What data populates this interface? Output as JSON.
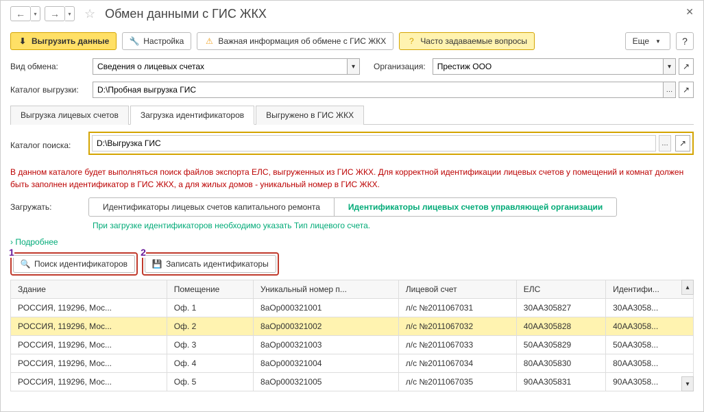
{
  "header": {
    "title": "Обмен данными с ГИС ЖКХ"
  },
  "toolbar": {
    "unload": "Выгрузить данные",
    "settings": "Настройка",
    "warning": "Важная информация об обмене с ГИС ЖКХ",
    "faq": "Часто задаваемые вопросы",
    "more": "Еще"
  },
  "form": {
    "exchange_type_lbl": "Вид обмена:",
    "exchange_type_val": "Сведения о лицевых счетах",
    "org_lbl": "Организация:",
    "org_val": "Престиж ООО",
    "export_dir_lbl": "Каталог выгрузки:",
    "export_dir_val": "D:\\Пробная выгрузка ГИС"
  },
  "tabs": [
    {
      "label": "Выгрузка лицевых счетов",
      "active": false
    },
    {
      "label": "Загрузка идентификаторов",
      "active": true
    },
    {
      "label": "Выгружено в ГИС ЖКХ",
      "active": false
    }
  ],
  "search": {
    "lbl": "Каталог поиска:",
    "val": "D:\\Выгрузка ГИС"
  },
  "hint": "В данном каталоге будет выполняться поиск файлов экспорта ЕЛС, выгруженных из ГИС ЖКХ. Для корректной идентификации лицевых счетов у помещений и комнат должен быть заполнен идентификатор в ГИС ЖКХ, а для жилых домов - уникальный номер в ГИС ЖКХ.",
  "load": {
    "lbl": "Загружать:",
    "opt1": "Идентификаторы лицевых счетов капитального ремонта",
    "opt2": "Идентификаторы лицевых счетов управляющей организации"
  },
  "green_hint": "При загрузке идентификаторов необходимо указать Тип лицевого счета.",
  "more_link": "Подробнее",
  "actions": {
    "search_ids": "Поиск идентификаторов",
    "write_ids": "Записать идентификаторы"
  },
  "table": {
    "cols": [
      "Здание",
      "Помещение",
      "Уникальный номер п...",
      "Лицевой счет",
      "ЕЛС",
      "Идентифи..."
    ],
    "rows": [
      {
        "b": "РОССИЯ, 119296, Мос...",
        "r": "Оф. 1",
        "u": "8аОр000321001",
        "a": "л/с №2011067031",
        "e": "30АА305827",
        "i": "30АА3058..."
      },
      {
        "b": "РОССИЯ, 119296, Мос...",
        "r": "Оф. 2",
        "u": "8аОр000321002",
        "a": "л/с №2011067032",
        "e": "40АА305828",
        "i": "40АА3058...",
        "sel": true
      },
      {
        "b": "РОССИЯ, 119296, Мос...",
        "r": "Оф. 3",
        "u": "8аОр000321003",
        "a": "л/с №2011067033",
        "e": "50АА305829",
        "i": "50АА3058..."
      },
      {
        "b": "РОССИЯ, 119296, Мос...",
        "r": "Оф. 4",
        "u": "8аОр000321004",
        "a": "л/с №2011067034",
        "e": "80АА305830",
        "i": "80АА3058..."
      },
      {
        "b": "РОССИЯ, 119296, Мос...",
        "r": "Оф. 5",
        "u": "8аОр000321005",
        "a": "л/с №2011067035",
        "e": "90АА305831",
        "i": "90АА3058..."
      }
    ]
  }
}
